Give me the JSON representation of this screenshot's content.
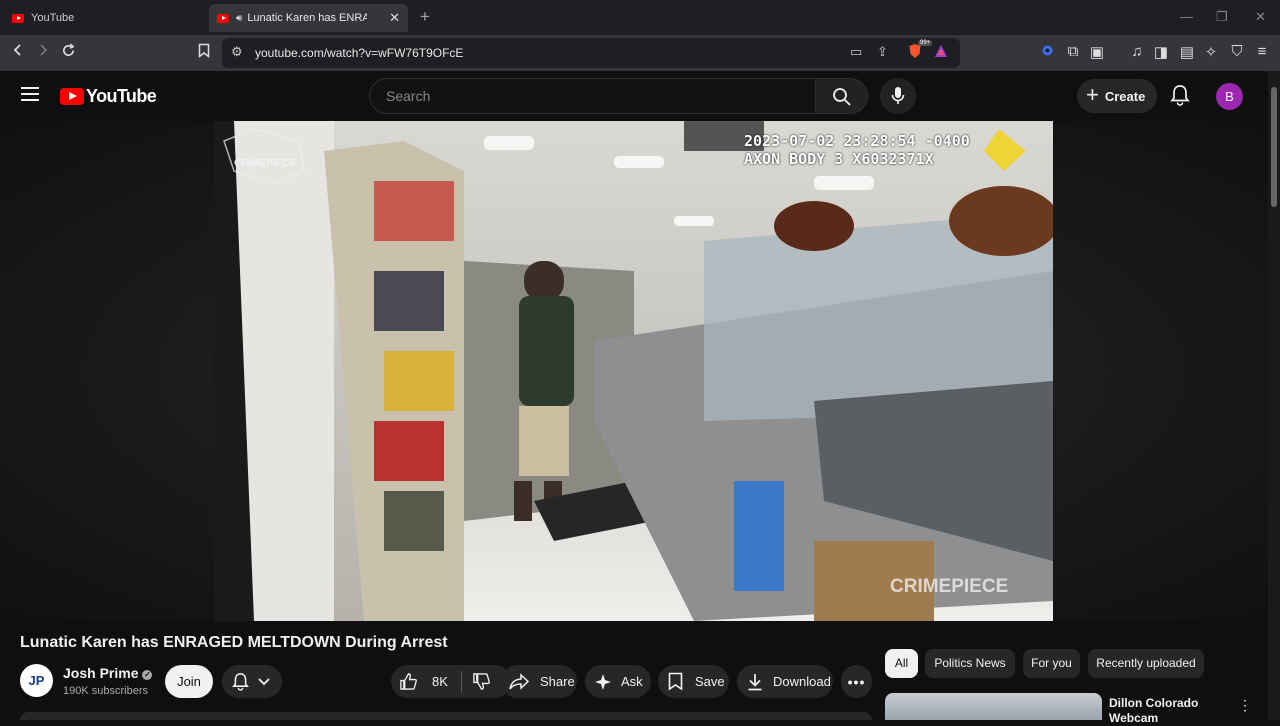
{
  "browser": {
    "tabs": [
      {
        "title": "YouTube",
        "active": false
      },
      {
        "title": "Lunatic Karen has ENRAGED MELTDOWN During Arrest",
        "active": true
      }
    ],
    "url": "youtube.com/watch?v=wFW76T9OFcE",
    "brave_badge": "99+"
  },
  "header": {
    "logo_text": "YouTube",
    "search_placeholder": "Search",
    "create_label": "Create",
    "avatar_letter": "B"
  },
  "video": {
    "timestamp_line1": "2023-07-02 23:28:54 -0400",
    "timestamp_line2": "AXON BODY 3 X6032371X",
    "watermark_top": "CRIMEPIECE",
    "watermark_bottom": "CRIMEPIECE",
    "title": "Lunatic Karen has ENRAGED MELTDOWN During Arrest"
  },
  "channel": {
    "avatar_text": "JP",
    "name": "Josh Prime",
    "subscribers": "190K subscribers",
    "join_label": "Join"
  },
  "actions": {
    "like_count": "8K",
    "share_label": "Share",
    "ask_label": "Ask",
    "save_label": "Save",
    "download_label": "Download"
  },
  "chips": [
    "All",
    "Politics News",
    "For you",
    "Recently uploaded"
  ],
  "recommendation": {
    "title": "Dillon Colorado Webcam"
  },
  "colors": {
    "accent": "#ff0000",
    "background": "#0f0f0f",
    "avatar": "#9c27b0"
  }
}
